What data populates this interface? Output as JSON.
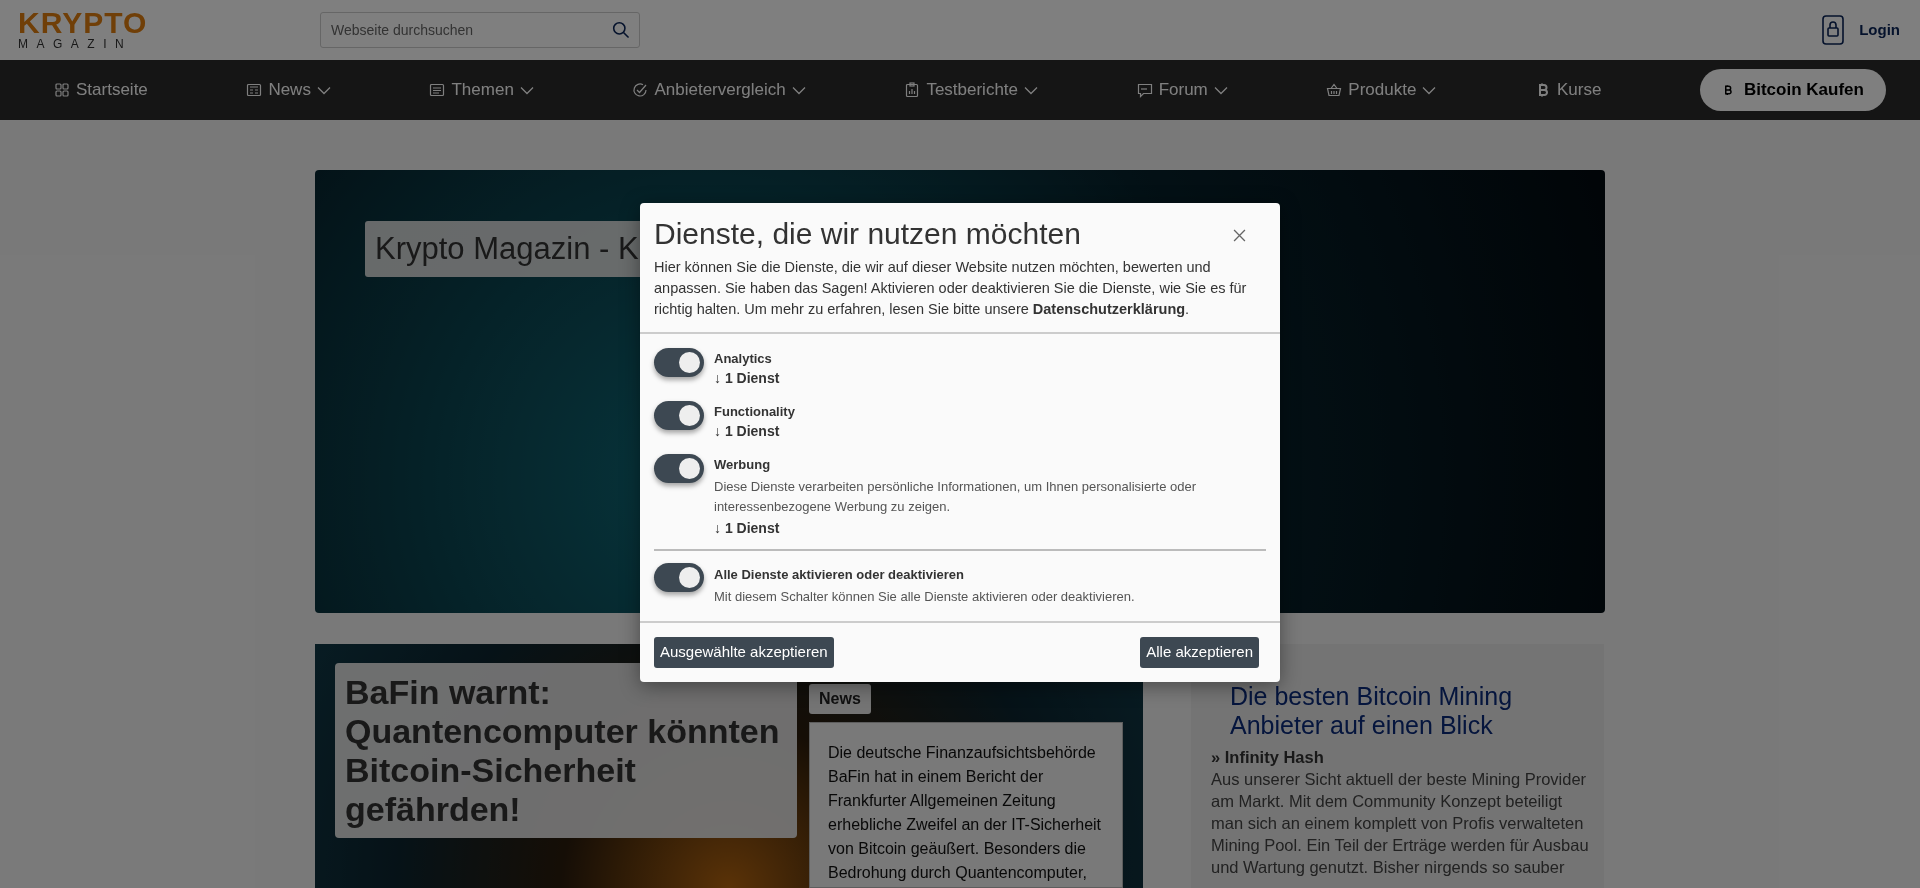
{
  "header": {
    "logo": {
      "top": "KRYPTO",
      "bottom": "MAGAZIN"
    },
    "search": {
      "placeholder": "Webseite durchsuchen"
    },
    "login": "Login"
  },
  "nav": {
    "items": [
      {
        "label": "Startseite",
        "kind": "home",
        "dropdown": false
      },
      {
        "label": "News",
        "kind": "news",
        "dropdown": true
      },
      {
        "label": "Themen",
        "kind": "topics",
        "dropdown": true
      },
      {
        "label": "Anbietervergleich",
        "kind": "compare",
        "dropdown": true
      },
      {
        "label": "Testberichte",
        "kind": "reviews",
        "dropdown": true
      },
      {
        "label": "Forum",
        "kind": "forum",
        "dropdown": true
      },
      {
        "label": "Produkte",
        "kind": "shop",
        "dropdown": true
      },
      {
        "label": "Kurse",
        "kind": "prices",
        "dropdown": false
      }
    ],
    "cta": "Bitcoin Kaufen"
  },
  "hero": {
    "title": "Krypto Magazin - K"
  },
  "article": {
    "title": "BaFin warnt: Quantencomputer könnten Bitcoin-Sicherheit gefährden!",
    "tag": "News",
    "excerpt": "Die deutsche Finanzaufsichtsbehörde BaFin hat in einem Bericht der Frankfurter Allgemeinen Zeitung erhebliche Zweifel an der IT-Sicherheit von Bitcoin geäußert. Besonders die Bedrohung durch Quantencomputer,"
  },
  "sidebar": {
    "title": "Die besten Bitcoin Mining Anbieter auf einen Blick",
    "entry_title": "» Infinity Hash",
    "entry_text": "Aus unserer Sicht aktuell der beste Mining Provider am Markt. Mit dem Community Konzept beteiligt man sich an einem komplett von Profis verwalteten Mining Pool. Ein Teil der Erträge werden für Ausbau und Wartung genutzt. Bisher nirgends so sauber"
  },
  "dialog": {
    "title": "Dienste, die wir nutzen möchten",
    "intro": "Hier können Sie die Dienste, die wir auf dieser Website nutzen möchten, bewerten und anpassen. Sie haben das Sagen! Aktivieren oder deaktivieren Sie die Dienste, wie Sie es für richtig halten. Um mehr zu erfahren, lesen Sie bitte unsere **Datenschutzerklärung**.",
    "services": [
      {
        "name": "Analytics",
        "on": true,
        "count": "↓ 1 Dienst"
      },
      {
        "name": "Functionality",
        "on": true,
        "count": "↓ 1 Dienst"
      },
      {
        "name": "Werbung",
        "on": true,
        "description": "Diese Dienste verarbeiten persönliche Informationen, um Ihnen personalisierte oder interessenbezogene Werbung zu zeigen.",
        "count": "↓ 1 Dienst"
      }
    ],
    "all_toggle": {
      "name": "Alle Dienste aktivieren oder deaktivieren",
      "on": true,
      "description": "Mit diesem Schalter können Sie alle Dienste aktivieren oder deaktivieren."
    },
    "buttons": [
      "Ausgewählte akzeptieren",
      "Alle akzeptieren"
    ]
  }
}
